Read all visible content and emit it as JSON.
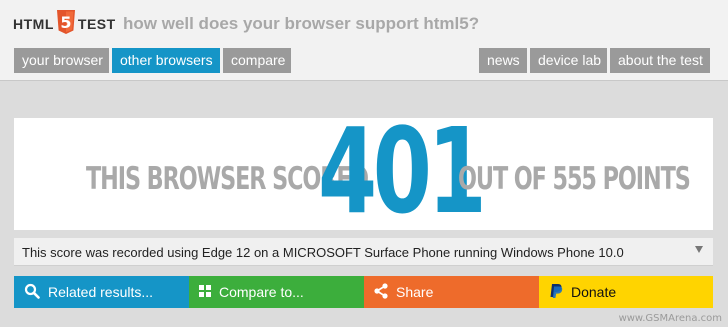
{
  "logo": {
    "left": "HTML",
    "badge": "5",
    "right": "TEST"
  },
  "tagline": "how well does your browser support html5?",
  "nav": {
    "left": [
      {
        "label": "your browser"
      },
      {
        "label": "other browsers"
      },
      {
        "label": "compare"
      }
    ],
    "right": [
      {
        "label": "news"
      },
      {
        "label": "device lab"
      },
      {
        "label": "about the test"
      }
    ]
  },
  "score": {
    "prefix": "THIS BROWSER SCORED",
    "value": "401",
    "suffix": "OUT OF 555 POINTS"
  },
  "detail": "This score was recorded using Edge 12 on a MICROSOFT Surface Phone running Windows Phone 10.0",
  "actions": {
    "related": "Related results...",
    "compare": "Compare to...",
    "share": "Share",
    "donate": "Donate"
  },
  "watermark": "www.GSMArena.com",
  "colors": {
    "accent": "#1595c7",
    "compare": "#3cae3c",
    "share": "#ee6b2b",
    "donate": "#ffd400",
    "nav_inactive": "#9a9a9a",
    "score_text": "#a9a9a9"
  },
  "icons": {
    "related": "search-icon",
    "compare": "grid-icon",
    "share": "share-icon",
    "donate": "paypal-icon",
    "detail": "chevron-down-icon"
  }
}
